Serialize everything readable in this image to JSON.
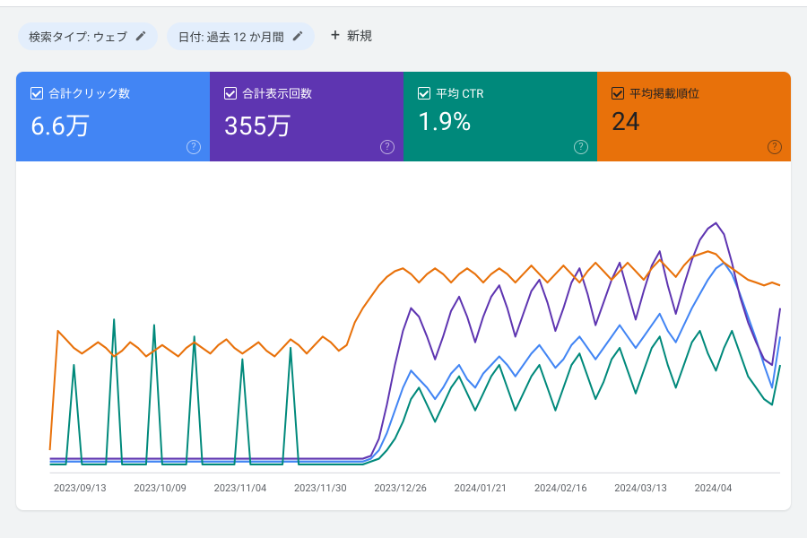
{
  "filters": {
    "search_type": {
      "label": "検索タイプ: ウェブ"
    },
    "date": {
      "label": "日付: 過去 12 か月間"
    },
    "add_new": "新規"
  },
  "metrics": [
    {
      "id": "clicks",
      "label": "合計クリック数",
      "value": "6.6万",
      "color": "#4285f4"
    },
    {
      "id": "impressions",
      "label": "合計表示回数",
      "value": "355万",
      "color": "#5e35b1"
    },
    {
      "id": "ctr",
      "label": "平均 CTR",
      "value": "1.9%",
      "color": "#00897b"
    },
    {
      "id": "position",
      "label": "平均掲載順位",
      "value": "24",
      "color": "#e8710a"
    }
  ],
  "chart_data": {
    "type": "line",
    "x_ticks": [
      "2023/09/13",
      "2023/10/09",
      "2023/11/04",
      "2023/11/30",
      "2023/12/26",
      "2024/01/21",
      "2024/02/16",
      "2024/03/13",
      "2024/04"
    ],
    "xlabel": "",
    "ylabel": "",
    "ylim": [
      0,
      100
    ],
    "note": "Y values are normalized 0–100 (relative scale — exact counts not labeled on chart).",
    "series": [
      {
        "name": "合計クリック数",
        "color": "#4285f4",
        "values": [
          4,
          4,
          4,
          4,
          4,
          4,
          4,
          4,
          4,
          4,
          4,
          4,
          4,
          4,
          4,
          4,
          4,
          4,
          4,
          4,
          4,
          4,
          4,
          4,
          4,
          4,
          4,
          4,
          4,
          4,
          4,
          4,
          4,
          4,
          4,
          4,
          4,
          4,
          4,
          4,
          5,
          8,
          14,
          22,
          30,
          36,
          33,
          30,
          26,
          30,
          35,
          38,
          33,
          30,
          35,
          38,
          41,
          38,
          34,
          38,
          42,
          45,
          41,
          37,
          40,
          45,
          48,
          44,
          40,
          44,
          48,
          52,
          48,
          44,
          48,
          52,
          56,
          50,
          46,
          52,
          58,
          63,
          68,
          72,
          74,
          70,
          63,
          55,
          47,
          38,
          30,
          48
        ]
      },
      {
        "name": "合計表示回数",
        "color": "#5e35b1",
        "values": [
          5,
          5,
          5,
          5,
          5,
          5,
          5,
          5,
          5,
          5,
          5,
          5,
          5,
          5,
          5,
          5,
          5,
          5,
          5,
          5,
          5,
          5,
          5,
          5,
          5,
          5,
          5,
          5,
          5,
          5,
          5,
          5,
          5,
          5,
          5,
          5,
          5,
          5,
          5,
          5,
          6,
          12,
          24,
          38,
          50,
          58,
          55,
          48,
          40,
          48,
          57,
          62,
          55,
          46,
          55,
          62,
          66,
          58,
          48,
          56,
          64,
          68,
          60,
          50,
          58,
          67,
          72,
          63,
          52,
          60,
          68,
          74,
          64,
          54,
          64,
          73,
          78,
          66,
          56,
          66,
          75,
          82,
          86,
          88,
          84,
          74,
          62,
          53,
          46,
          40,
          38,
          58
        ]
      },
      {
        "name": "平均 CTR",
        "color": "#00897b",
        "values": [
          3,
          3,
          3,
          38,
          3,
          3,
          3,
          3,
          54,
          3,
          3,
          3,
          3,
          52,
          3,
          3,
          3,
          3,
          48,
          3,
          3,
          3,
          3,
          3,
          40,
          3,
          3,
          3,
          3,
          3,
          44,
          3,
          3,
          3,
          3,
          3,
          3,
          3,
          3,
          3,
          4,
          5,
          8,
          12,
          18,
          26,
          30,
          24,
          18,
          24,
          30,
          34,
          28,
          22,
          28,
          34,
          38,
          30,
          22,
          28,
          34,
          38,
          30,
          22,
          30,
          38,
          42,
          34,
          26,
          32,
          40,
          44,
          36,
          28,
          36,
          44,
          48,
          38,
          30,
          38,
          46,
          50,
          42,
          36,
          44,
          50,
          42,
          34,
          30,
          26,
          24,
          38
        ]
      },
      {
        "name": "平均掲載順位",
        "color": "#e8710a",
        "values": [
          8,
          50,
          47,
          44,
          42,
          44,
          46,
          44,
          41,
          43,
          46,
          44,
          41,
          43,
          45,
          43,
          41,
          44,
          46,
          44,
          42,
          45,
          47,
          44,
          42,
          44,
          46,
          43,
          41,
          44,
          47,
          45,
          42,
          45,
          48,
          46,
          43,
          45,
          53,
          58,
          62,
          66,
          69,
          71,
          72,
          70,
          67,
          70,
          72,
          70,
          67,
          70,
          72,
          70,
          67,
          70,
          72,
          70,
          67,
          70,
          73,
          70,
          67,
          70,
          73,
          70,
          67,
          71,
          74,
          71,
          68,
          71,
          74,
          71,
          68,
          72,
          75,
          72,
          69,
          73,
          76,
          77,
          78,
          77,
          74,
          72,
          70,
          68,
          67,
          66,
          67,
          66
        ]
      }
    ]
  }
}
